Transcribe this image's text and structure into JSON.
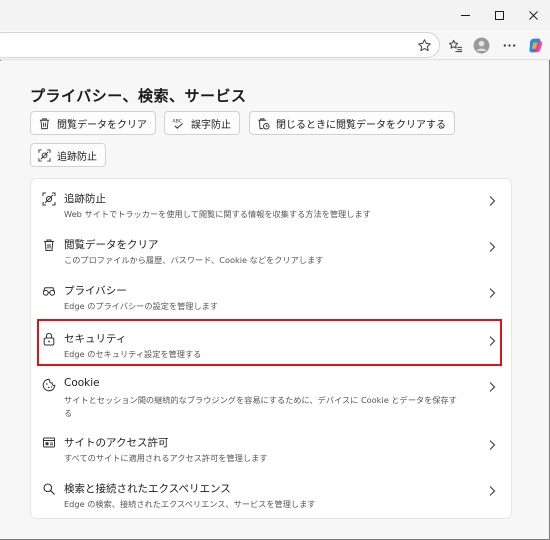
{
  "browser": {
    "window_controls": [
      "minimize",
      "maximize",
      "close"
    ],
    "toolbar_icons": [
      "star-icon",
      "favorites-icon",
      "profile-avatar",
      "more-icon",
      "copilot-icon"
    ]
  },
  "page": {
    "title": "プライバシー、検索、サービス"
  },
  "quick_links": [
    {
      "label": "閲覧データをクリア",
      "icon": "trash-icon"
    },
    {
      "label": "誤字防止",
      "icon": "spellcheck-icon"
    },
    {
      "label": "閉じるときに閲覧データをクリアする",
      "icon": "trash-clock-icon"
    },
    {
      "label": "追跡防止",
      "icon": "tracking-icon"
    }
  ],
  "settings": [
    {
      "title": "追跡防止",
      "desc": "Web サイトでトラッカーを使用して閲覧に関する情報を収集する方法を管理します",
      "icon": "tracking-icon"
    },
    {
      "title": "閲覧データをクリア",
      "desc": "このプロファイルから履歴、パスワード、Cookie などをクリアします",
      "icon": "trash-icon"
    },
    {
      "title": "プライバシー",
      "desc": "Edge のプライバシーの設定を管理します",
      "icon": "glasses-icon"
    },
    {
      "title": "セキュリティ",
      "desc": "Edge のセキュリティ設定を管理する",
      "icon": "lock-icon"
    },
    {
      "title": "Cookie",
      "desc": "サイトとセッション間の継続的なブラウジングを容易にするために、デバイスに Cookie とデータを保存す",
      "desc2": "る",
      "icon": "cookie-icon"
    },
    {
      "title": "サイトのアクセス許可",
      "desc": "すべてのサイトに適用されるアクセス許可を管理します",
      "icon": "site-permissions-icon"
    },
    {
      "title": "検索と接続されたエクスペリエンス",
      "desc": "Edge の検索、接続されたエクスペリエンス、サービスを管理します",
      "icon": "search-icon"
    }
  ],
  "highlighted_item": "セキュリティ",
  "colors": {
    "highlight": "#d9141b",
    "background": "#f7f7f7",
    "card": "#ffffff"
  }
}
